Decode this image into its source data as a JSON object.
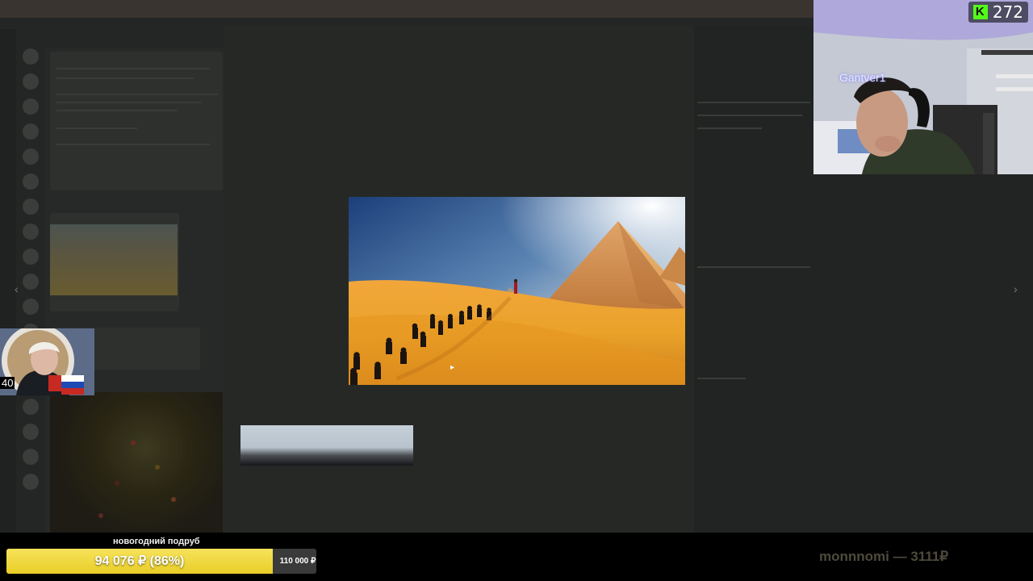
{
  "lightbox": {
    "prev_arrow": "‹",
    "next_arrow": "›",
    "cursor": "▸"
  },
  "webcam": {
    "viewer_count": "272",
    "platform_icon": "kick-logo",
    "platform_letter": "K",
    "streamer_name": "Gantver1"
  },
  "small_cam": {
    "number": "40"
  },
  "donation_goal": {
    "title": "новогодний подруб",
    "progress_text": "94 076 ₽ (86%)",
    "progress_fraction": 0.86,
    "target": "110 000 ₽"
  },
  "last_donation": {
    "text": "monnnomi — 3111₽"
  },
  "colors": {
    "goal_fill": "#e9cd27",
    "kick_green": "#53fc18"
  }
}
